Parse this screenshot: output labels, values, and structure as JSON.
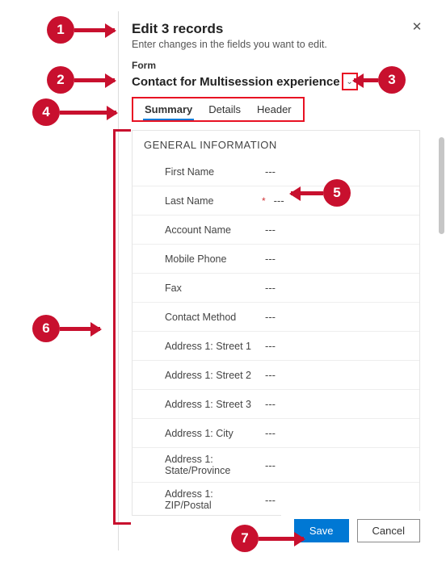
{
  "title": "Edit 3 records",
  "subtitle": "Enter changes in the fields you want to edit.",
  "form_label": "Form",
  "form_name": "Contact for Multisession experience",
  "tabs": [
    "Summary",
    "Details",
    "Header"
  ],
  "section_title": "GENERAL INFORMATION",
  "placeholder": "---",
  "fields": [
    {
      "label": "First Name",
      "required": false
    },
    {
      "label": "Last Name",
      "required": true
    },
    {
      "label": "Account Name",
      "required": false
    },
    {
      "label": "Mobile Phone",
      "required": false
    },
    {
      "label": "Fax",
      "required": false
    },
    {
      "label": "Contact Method",
      "required": false
    },
    {
      "label": "Address 1: Street 1",
      "required": false
    },
    {
      "label": "Address 1: Street 2",
      "required": false
    },
    {
      "label": "Address 1: Street 3",
      "required": false
    },
    {
      "label": "Address 1: City",
      "required": false
    },
    {
      "label": "Address 1: State/Province",
      "required": false
    },
    {
      "label": "Address 1: ZIP/Postal",
      "required": false
    }
  ],
  "buttons": {
    "save": "Save",
    "cancel": "Cancel"
  },
  "callouts": [
    "1",
    "2",
    "3",
    "4",
    "5",
    "6",
    "7"
  ]
}
